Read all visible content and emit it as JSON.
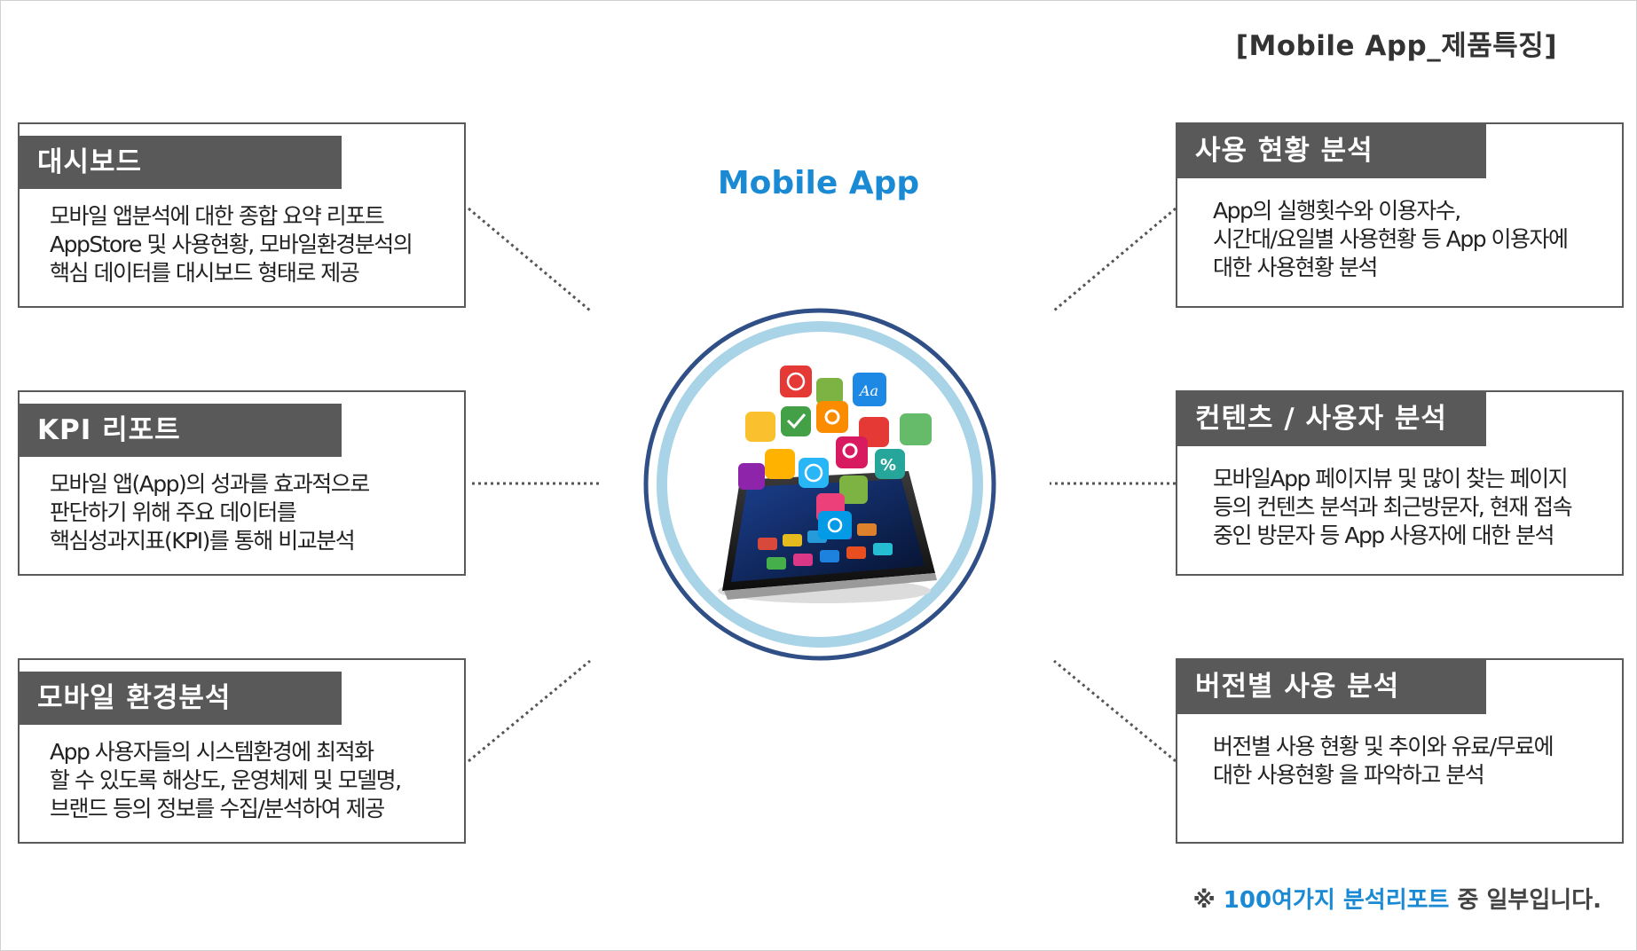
{
  "page_title": "[Mobile App_제품특징]",
  "center_title": "Mobile App",
  "cards": {
    "dashboard": {
      "title": "대시보드",
      "lines": [
        "모바일 앱분석에 대한 종합 요약 리포트",
        "AppStore 및 사용현황, 모바일환경분석의",
        "핵심 데이터를 대시보드 형태로 제공"
      ]
    },
    "kpi": {
      "title": "KPI 리포트",
      "lines": [
        "모바일 앱(App)의 성과를 효과적으로",
        "판단하기 위해 주요 데이터를",
        "핵심성과지표(KPI)를 통해 비교분석"
      ]
    },
    "env": {
      "title": "모바일 환경분석",
      "lines": [
        "App 사용자들의 시스템환경에 최적화",
        "할 수 있도록 해상도, 운영체제 및 모델명,",
        "브랜드 등의 정보를 수집/분석하여 제공"
      ]
    },
    "usage": {
      "title": "사용 현황 분석",
      "lines": [
        "App의 실행횟수와 이용자수,",
        "시간대/요일별 사용현황 등 App 이용자에",
        "대한 사용현황 분석"
      ]
    },
    "content": {
      "title": "컨텐츠 / 사용자 분석",
      "lines": [
        "모바일App 페이지뷰 및 많이 찾는 페이지",
        "등의 컨텐츠 분석과 최근방문자, 현재 접속",
        "중인 방문자 등 App 사용자에 대한 분석"
      ]
    },
    "version": {
      "title": "버전별 사용 분석",
      "lines": [
        "버전별 사용 현황 및 추이와 유료/무료에",
        "대한 사용현황 을 파악하고 분석"
      ]
    }
  },
  "footnote": {
    "prefix": "※ ",
    "highlight": "100여가지 분석리포트",
    "suffix": " 중 일부입니다."
  },
  "colors": {
    "accent_blue": "#1a8ad4",
    "header_gray": "#595959",
    "circle_outer": "#2f4f86",
    "circle_inner": "#a9d3e6"
  },
  "icons": [
    "info-icon",
    "puzzle-icon",
    "font-icon",
    "rss-icon",
    "check-icon",
    "gear-icon",
    "lock-icon",
    "globe-icon",
    "search-icon",
    "cart-icon",
    "percent-icon",
    "music-icon",
    "camera-icon",
    "mail-icon"
  ]
}
